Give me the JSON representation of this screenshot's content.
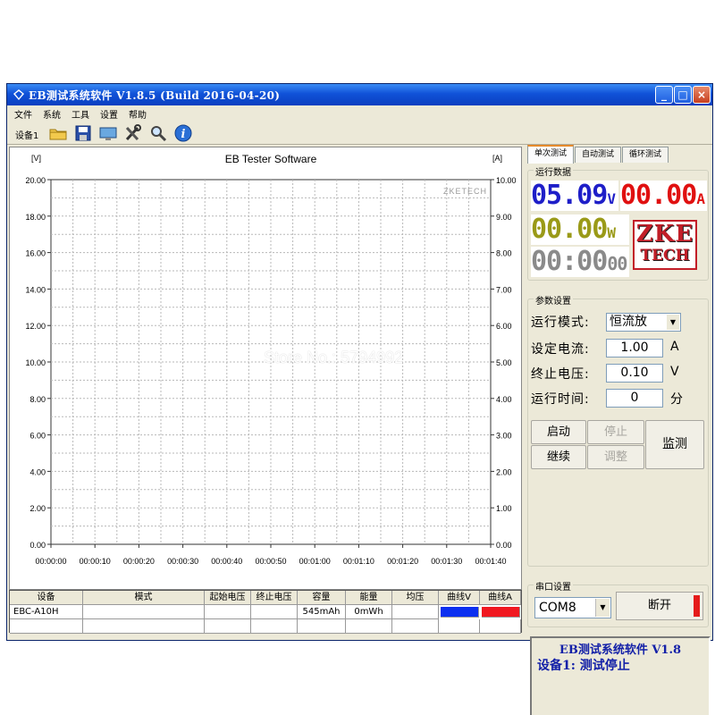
{
  "window": {
    "title": "EB测试系统软件 V1.8.5 (Build 2016-04-20)",
    "controls": [
      "_",
      "□",
      "×"
    ]
  },
  "menu": [
    "文件",
    "系统",
    "工具",
    "设置",
    "帮助"
  ],
  "toolbar": {
    "device_label": "设备1",
    "icons": [
      "folder-icon",
      "save-icon",
      "monitor-icon",
      "tools-icon",
      "search-icon",
      "info-icon"
    ]
  },
  "chart_data": {
    "type": "line",
    "title": "EB Tester Software",
    "y_left_label": "[V]",
    "y_right_label": "[A]",
    "watermark_text": "ZKETECH",
    "y_left_range": [
      0,
      20
    ],
    "y_right_range": [
      0,
      10
    ],
    "y_left_ticks": [
      "20.00",
      "18.00",
      "16.00",
      "14.00",
      "12.00",
      "10.00",
      "8.00",
      "6.00",
      "4.00",
      "2.00",
      "0.00"
    ],
    "y_right_ticks": [
      "10.00",
      "9.00",
      "8.00",
      "7.00",
      "6.00",
      "5.00",
      "4.00",
      "3.00",
      "2.00",
      "1.00",
      "0.00"
    ],
    "x_ticks": [
      "00:00:00",
      "00:00:10",
      "00:00:20",
      "00:00:30",
      "00:00:40",
      "00:00:50",
      "00:01:00",
      "00:01:10",
      "00:01:20",
      "00:01:30",
      "00:01:40"
    ],
    "series": [],
    "grid": true
  },
  "table": {
    "headers": [
      "设备",
      "模式",
      "起始电压",
      "终止电压",
      "容量",
      "能量",
      "均压",
      "曲线V",
      "曲线A"
    ],
    "rows": [
      [
        "EBC-A10H",
        "",
        "",
        "",
        "545mAh",
        "0mWh",
        "",
        "",
        ""
      ]
    ],
    "curve_colors": {
      "v": "#0b2ff0",
      "a": "#f01820"
    }
  },
  "tabs": [
    "单次测试",
    "自动测试",
    "循环测试"
  ],
  "run_data": {
    "group_title": "运行数据",
    "voltage": "05.09",
    "voltage_unit": "V",
    "current": "00.00",
    "current_unit": "A",
    "power": "00.00",
    "power_unit": "W",
    "time_main": "00:00",
    "time_sec": "00",
    "colors": {
      "voltage": "#1e1ec8",
      "current": "#e01010",
      "power": "#9a9a18",
      "time": "#8a8a8a"
    }
  },
  "logo": {
    "line1": "ZKE",
    "line2": "TECH"
  },
  "params": {
    "group_title": "参数设置",
    "mode_label": "运行模式:",
    "mode_value": "恒流放",
    "current_label": "设定电流:",
    "current_value": "1.00",
    "current_unit": "A",
    "voltage_label": "终止电压:",
    "voltage_value": "0.10",
    "voltage_unit": "V",
    "time_label": "运行时间:",
    "time_value": "0",
    "time_unit": "分"
  },
  "buttons": {
    "start": "启动",
    "stop": "停止",
    "continue": "继续",
    "adjust": "调整",
    "monitor": "监测"
  },
  "serial": {
    "group_title": "串口设置",
    "port": "COM8",
    "disconnect": "断开"
  },
  "status": {
    "line1": "EB测试系统软件 V1.8",
    "line2": "设备1: 测试停止"
  },
  "watermark": "Store No.: 5794992"
}
